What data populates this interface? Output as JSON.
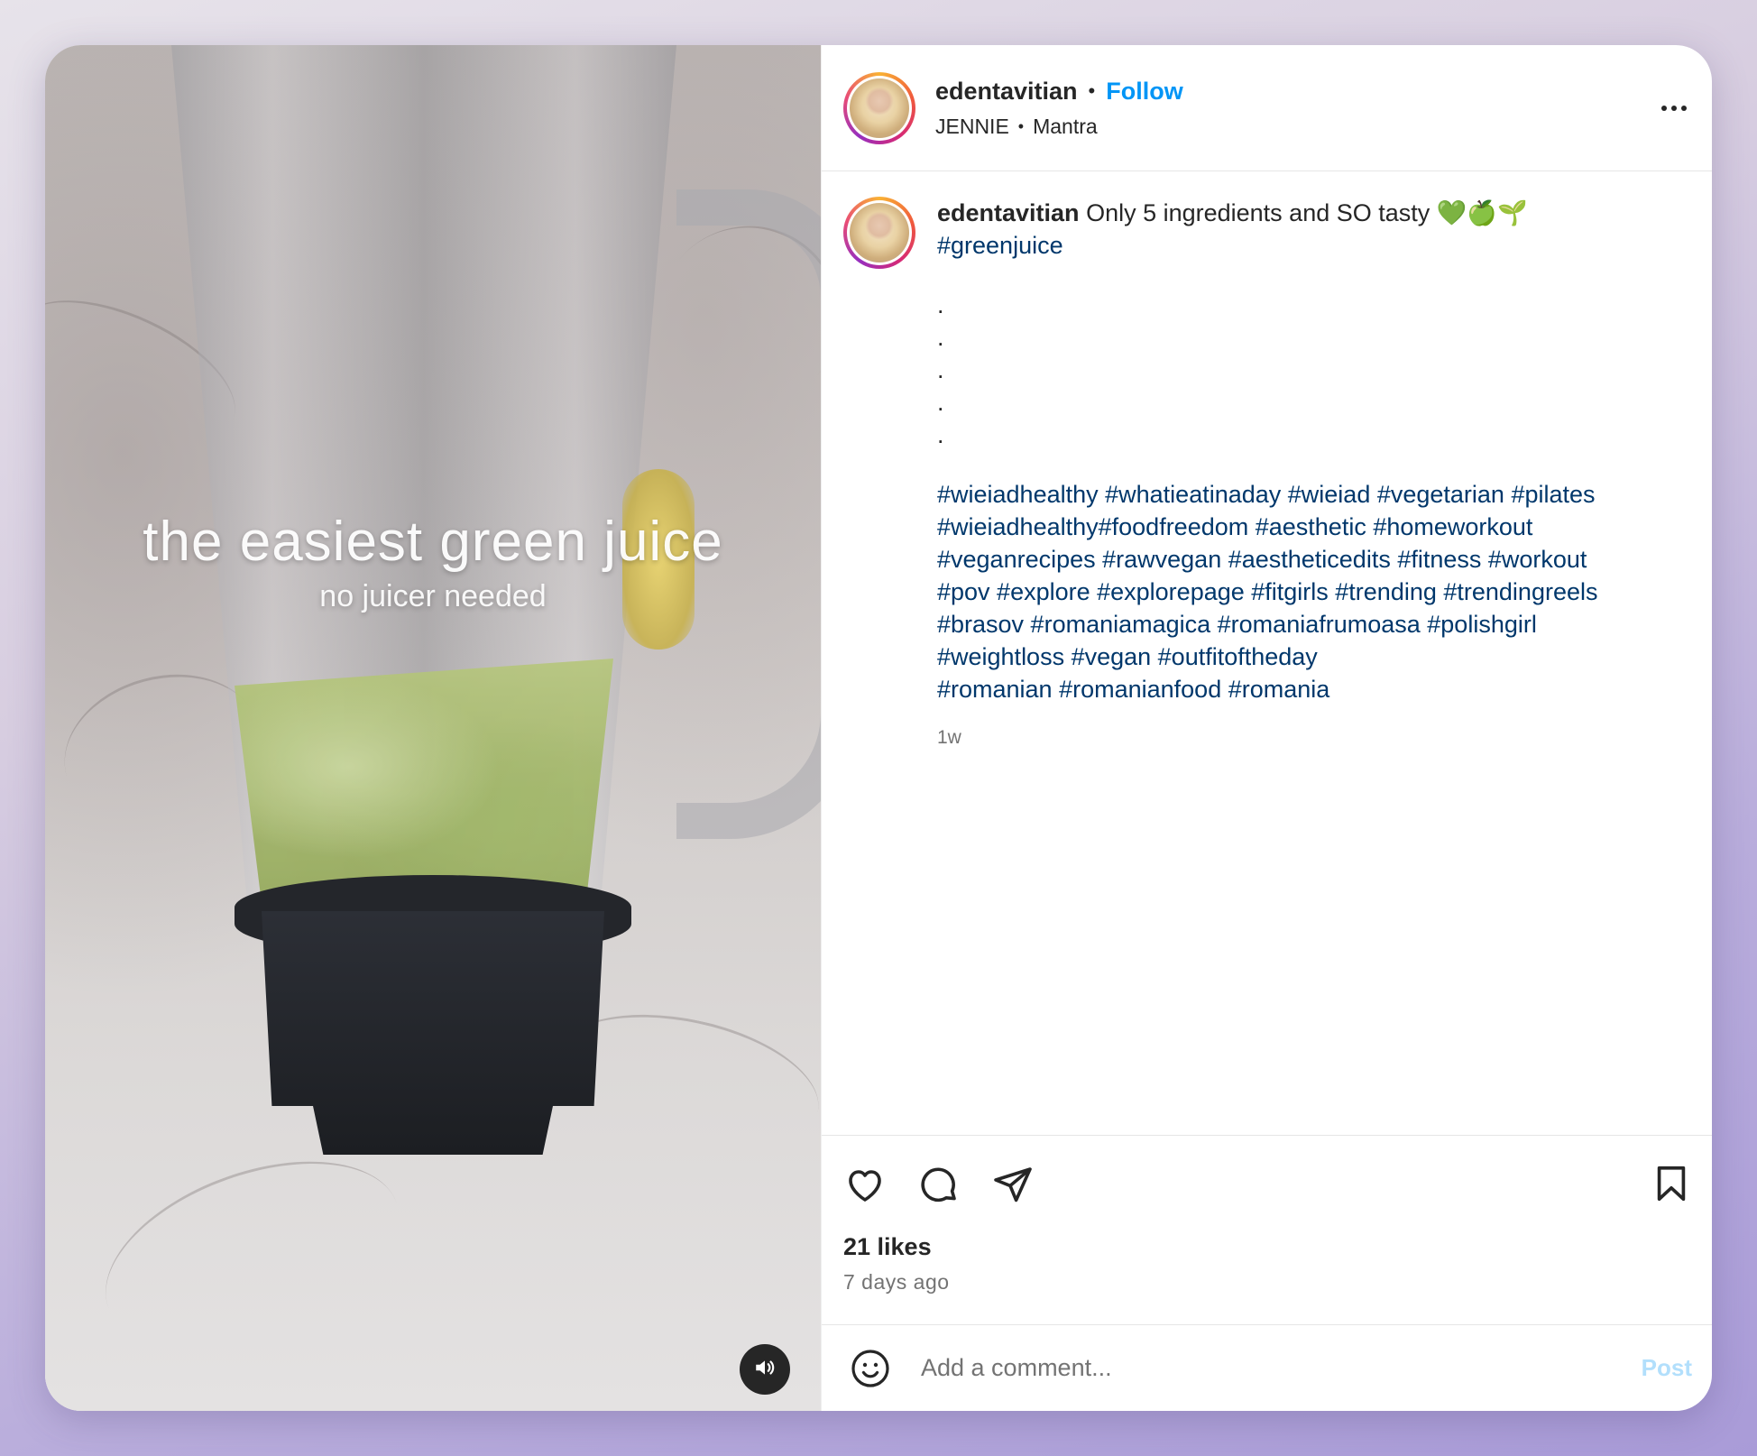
{
  "post": {
    "media": {
      "overlay_title": "the easiest green juice",
      "overlay_subtitle": "no juicer needed",
      "mute_icon": "speaker-icon"
    },
    "header": {
      "username": "edentavitian",
      "separator": "•",
      "follow_label": "Follow",
      "audio_artist": "JENNIE",
      "audio_separator": "•",
      "audio_track": "Mantra",
      "more_icon": "more-options-icon"
    },
    "caption": {
      "username": "edentavitian",
      "text": "Only 5 ingredients and SO tasty 💚🍏🌱",
      "hashtag": "#greenjuice",
      "dots": [
        ".",
        ".",
        ".",
        ".",
        "."
      ],
      "tag_lines": [
        "#wieiadhealthy #whatieatinaday #wieiad #vegetarian #pilates",
        "#wieiadhealthy#foodfreedom #aesthetic #homeworkout",
        "#veganrecipes #rawvegan #aestheticedits #fitness #workout",
        "#pov #explore #explorepage #fitgirls #trending #trendingreels",
        "#brasov #romaniamagica #romaniafrumoasa #polishgirl",
        "#weightloss #vegan #outfitoftheday",
        "#romanian #romanianfood #romania"
      ],
      "time_ago": "1w"
    },
    "actions": {
      "like_icon": "heart-icon",
      "comment_icon": "comment-icon",
      "share_icon": "share-icon",
      "save_icon": "bookmark-icon",
      "likes": "21 likes",
      "posted": "7 days ago"
    },
    "comment_bar": {
      "emoji_icon": "emoji-icon",
      "placeholder": "Add a comment...",
      "post_label": "Post"
    }
  },
  "colors": {
    "link_blue": "#0095f6",
    "hashtag_blue": "#00376b",
    "post_disabled": "#b2dffc",
    "muted_text": "#737373"
  }
}
